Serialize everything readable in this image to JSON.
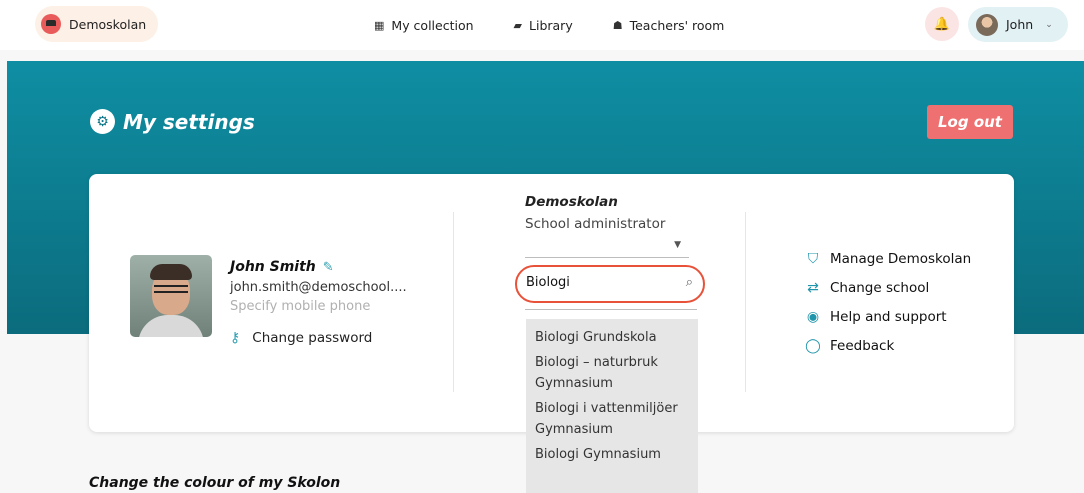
{
  "topnav": {
    "school_label": "Demoskolan",
    "nav_items": [
      {
        "label": "My collection",
        "icon": "grid-icon"
      },
      {
        "label": "Library",
        "icon": "book-icon"
      },
      {
        "label": "Teachers' room",
        "icon": "users-icon"
      }
    ],
    "user_label": "John"
  },
  "header": {
    "title": "My settings",
    "logout_label": "Log out"
  },
  "profile": {
    "name": "John Smith",
    "email": "john.smith@demoschool....",
    "phone_placeholder": "Specify mobile phone",
    "change_password_label": "Change password"
  },
  "school": {
    "name": "Demoskolan",
    "role": "School administrator",
    "subject_search_value": "Biologi",
    "suggestions": [
      "Biologi Grundskola",
      "Biologi – naturbruk Gymnasium",
      "Biologi i vattenmiljöer Gymnasium",
      "Biologi Gymnasium"
    ]
  },
  "links": [
    {
      "label": "Manage Demoskolan",
      "icon": "shield-icon"
    },
    {
      "label": "Change school",
      "icon": "swap-icon"
    },
    {
      "label": "Help and support",
      "icon": "lifebuoy-icon"
    },
    {
      "label": "Feedback",
      "icon": "chat-bubble-icon"
    }
  ],
  "colour_section_title": "Change the colour of my Skolon",
  "colors": {
    "banner": "#0b7f92",
    "logout": "#ee7070",
    "accent": "#1f95ab",
    "search_highlight": "#e8523a"
  }
}
